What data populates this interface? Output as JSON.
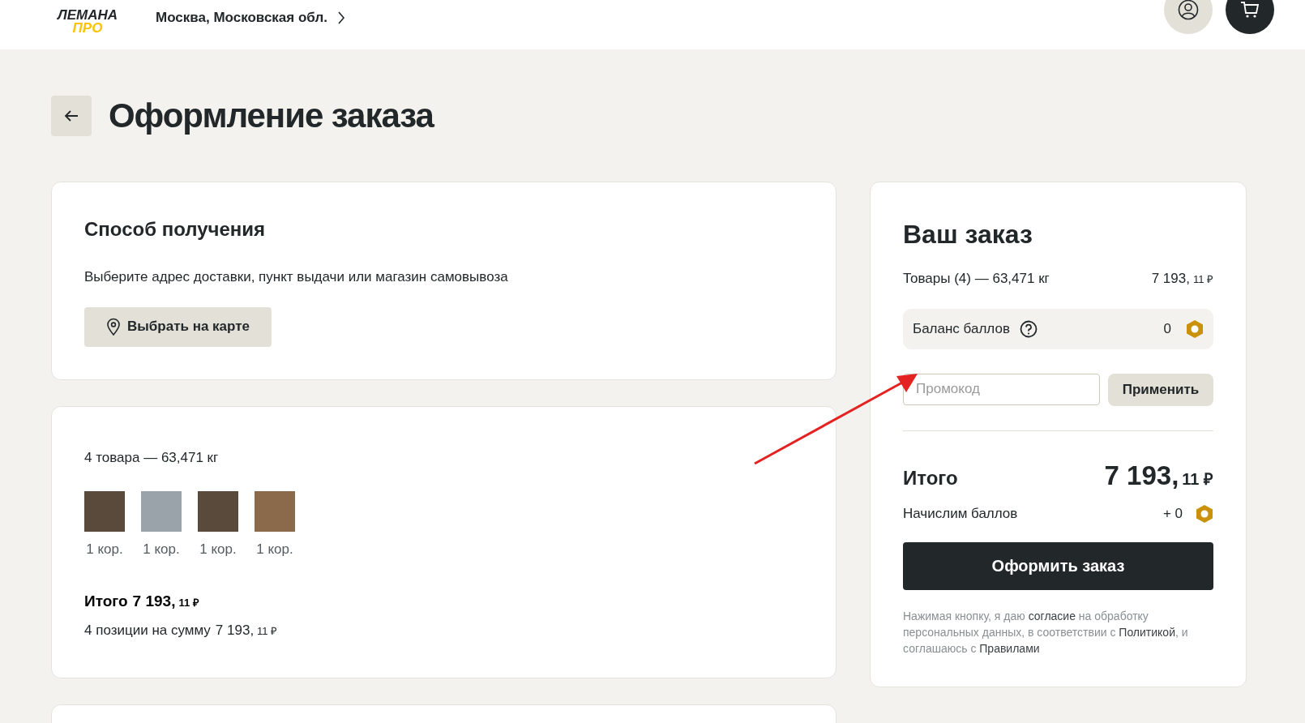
{
  "header": {
    "logo": {
      "line1": "ЛЕМАНА",
      "line2": "ПРО"
    },
    "location": "Москва, Московская обл."
  },
  "page": {
    "title": "Оформление заказа"
  },
  "delivery": {
    "title": "Способ получения",
    "description": "Выберите адрес доставки, пункт выдачи или магазин самовывоза",
    "button": "Выбрать на карте"
  },
  "items_card": {
    "summary": "4 товара — 63,471 кг",
    "items": [
      {
        "quantity": "1 кор."
      },
      {
        "quantity": "1 кор."
      },
      {
        "quantity": "1 кор."
      },
      {
        "quantity": "1 кор."
      }
    ],
    "total_label": "Итого",
    "total_amount": "7 193,",
    "total_fraction": "11 ₽",
    "positions_text": "4 позиции на сумму",
    "positions_amount": "7 193,",
    "positions_fraction": "11 ₽"
  },
  "order": {
    "title": "Ваш заказ",
    "goods_label": "Товары (4) — 63,471 кг",
    "goods_amount": "7 193,",
    "goods_fraction": "11 ₽",
    "balance_label": "Баланс баллов",
    "balance_value": "0",
    "promo": {
      "placeholder": "Промокод",
      "button": "Применить"
    },
    "total_label": "Итого",
    "total_amount": "7 193,",
    "total_fraction": "11 ₽",
    "bonus_label": "Начислим баллов",
    "bonus_value": "+ 0",
    "submit": "Оформить заказ",
    "legal": [
      {
        "kind": "text",
        "text": "Нажимая кнопку, я даю "
      },
      {
        "kind": "link",
        "text": "согласие"
      },
      {
        "kind": "text",
        "text": " на обработку персональных данных, в соответствии с "
      },
      {
        "kind": "link",
        "text": "Политикой"
      },
      {
        "kind": "text",
        "text": ", и соглашаюсь с "
      },
      {
        "kind": "link",
        "text": "Правилами"
      }
    ]
  }
}
